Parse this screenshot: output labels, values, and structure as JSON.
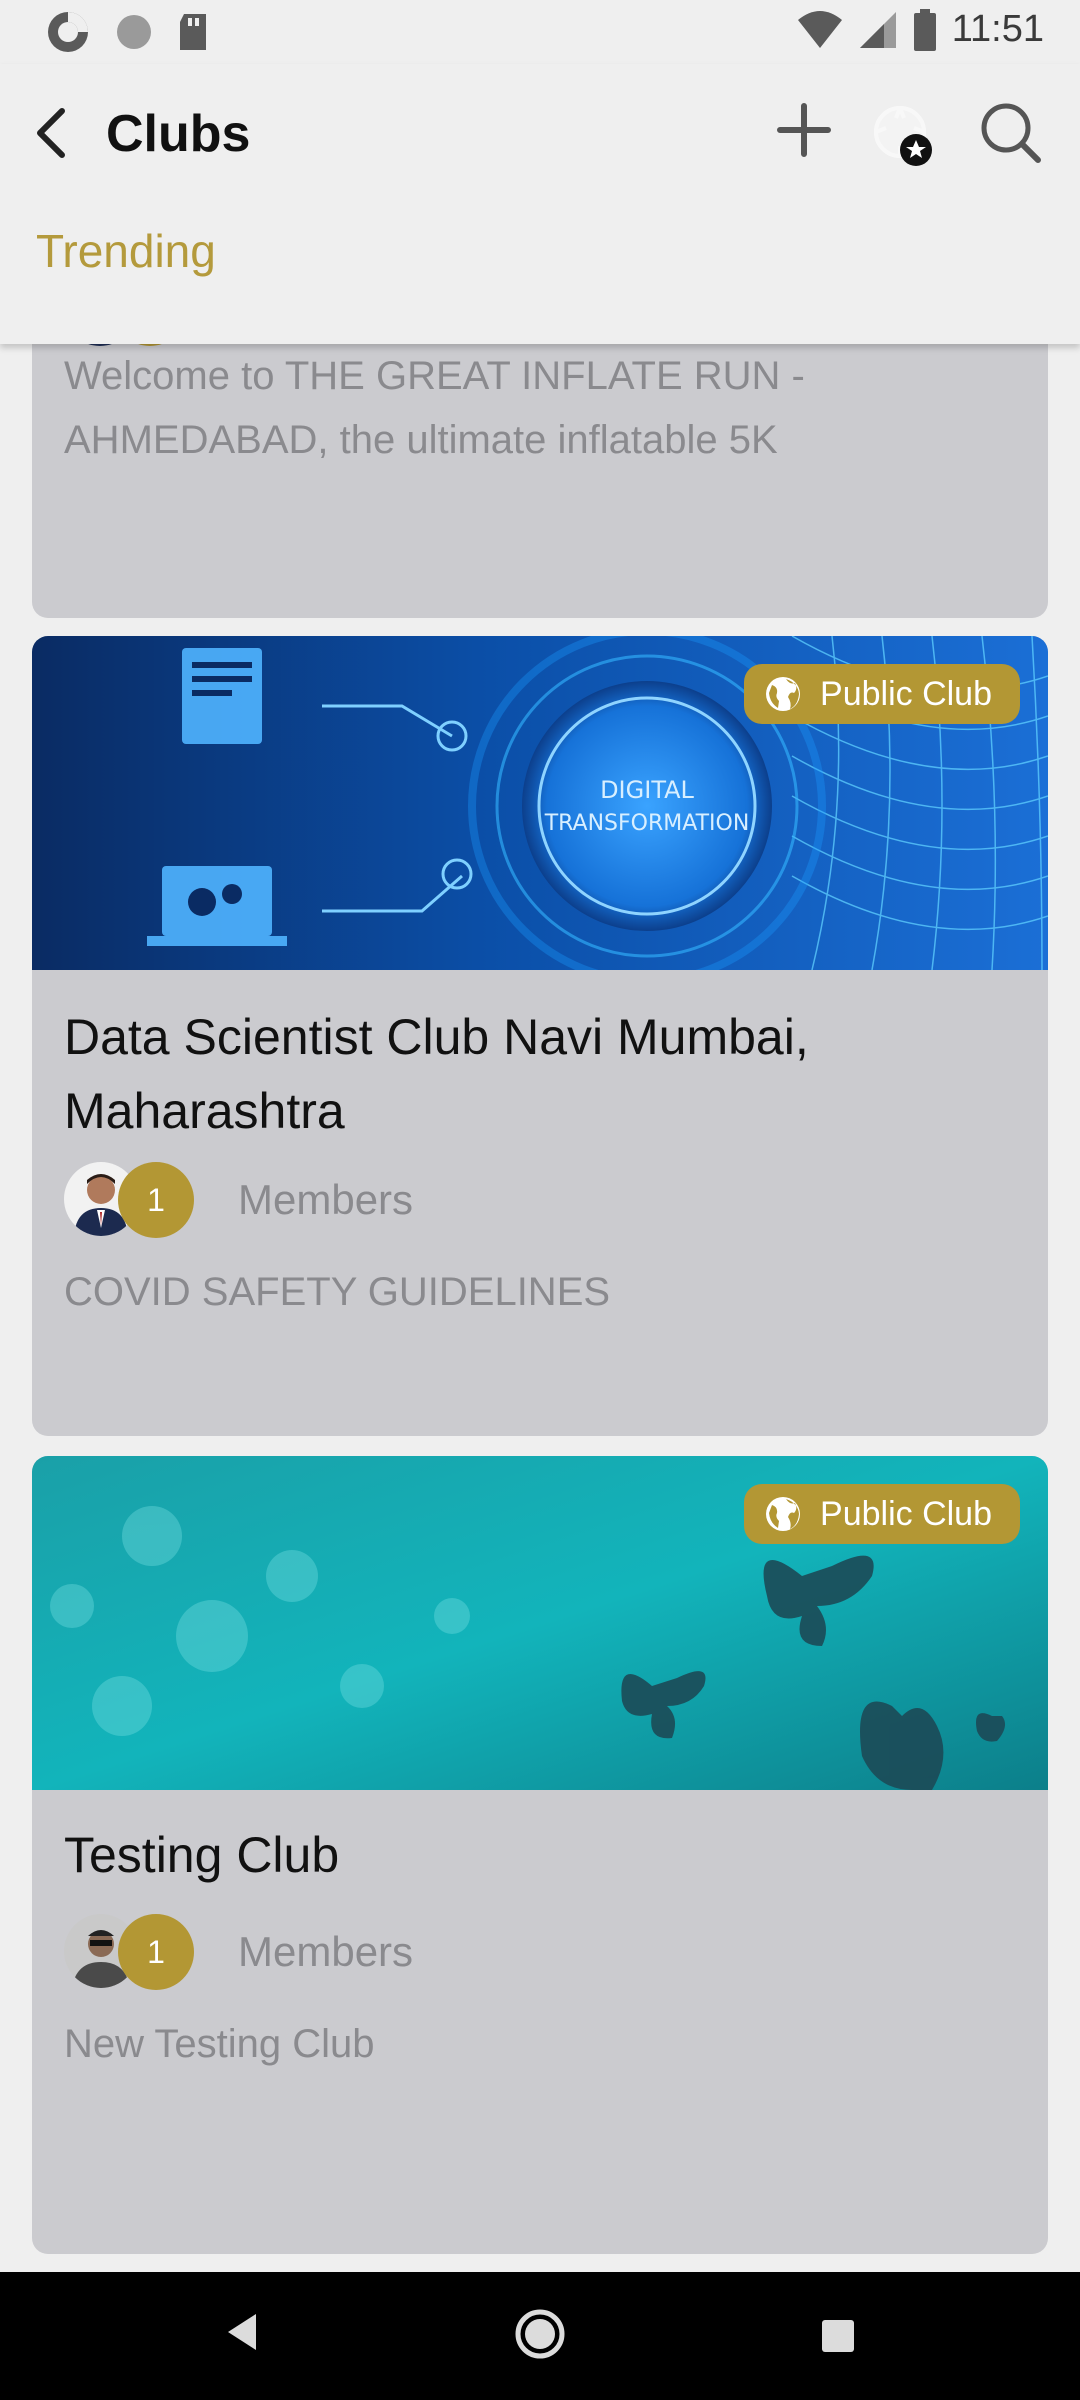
{
  "status_bar": {
    "time": "11:51",
    "left_icons": [
      "sync-icon",
      "circle-icon",
      "sd-card-icon"
    ],
    "right_icons": [
      "wifi-icon",
      "signal-icon",
      "battery-icon"
    ]
  },
  "app_bar": {
    "title": "Clubs",
    "actions": [
      "add-icon",
      "badge-icon",
      "search-icon"
    ]
  },
  "tabs": [
    {
      "label": "Trending",
      "active": true
    }
  ],
  "clubs": [
    {
      "title": "",
      "description": "Welcome to THE GREAT INFLATE RUN - AHMEDABAD, the ultimate inflatable 5K"
    },
    {
      "badge": "Public Club",
      "banner": "digital-transformation-image",
      "banner_text": [
        "DIGITAL",
        "TRANSFORMATION"
      ],
      "title": "Data Scientist Club  Navi Mumbai, Maharashtra",
      "member_count": "1",
      "members_label": "Members",
      "description": "COVID SAFETY GUIDELINES"
    },
    {
      "badge": "Public Club",
      "banner": "teal-butterflies-image",
      "title": "Testing Club",
      "member_count": "1",
      "members_label": "Members",
      "description": "New Testing Club"
    }
  ],
  "colors": {
    "accent": "#b39734",
    "card_bg": "#cbcbcf",
    "page_bg": "#efefef"
  },
  "nav_bar": [
    "nav-back-icon",
    "nav-home-icon",
    "nav-recents-icon"
  ]
}
